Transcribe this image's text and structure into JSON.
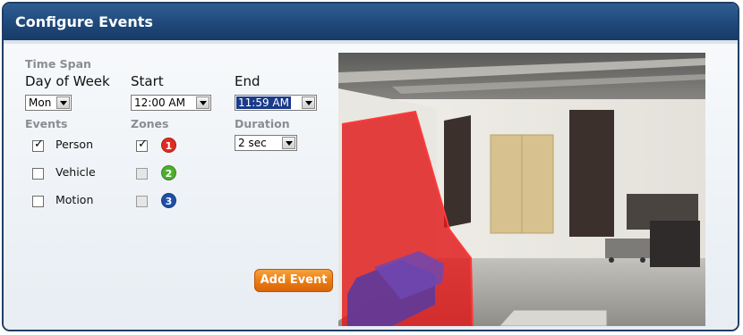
{
  "window": {
    "title": "Configure Events"
  },
  "time_span": {
    "section_label": "Time Span",
    "day_of_week": {
      "label": "Day of Week",
      "value": "Mon"
    },
    "start": {
      "label": "Start",
      "value": "12:00 AM"
    },
    "end": {
      "label": "End",
      "value": "11:59 AM"
    }
  },
  "events": {
    "label": "Events",
    "items": [
      {
        "label": "Person",
        "checked": true
      },
      {
        "label": "Vehicle",
        "checked": false
      },
      {
        "label": "Motion",
        "checked": false
      }
    ]
  },
  "zones": {
    "label": "Zones",
    "items": [
      {
        "number": "1",
        "checked": true,
        "color": "#e02b20"
      },
      {
        "number": "2",
        "checked": false,
        "color": "#4caf2e"
      },
      {
        "number": "3",
        "checked": false,
        "color": "#1f4fa8"
      }
    ]
  },
  "duration": {
    "label": "Duration",
    "value": "2 sec"
  },
  "actions": {
    "add_event_label": "Add Event"
  },
  "colors": {
    "title_bar": "#1e4778",
    "accent_button": "#ea7a10",
    "zone_overlay": "#e01818"
  }
}
